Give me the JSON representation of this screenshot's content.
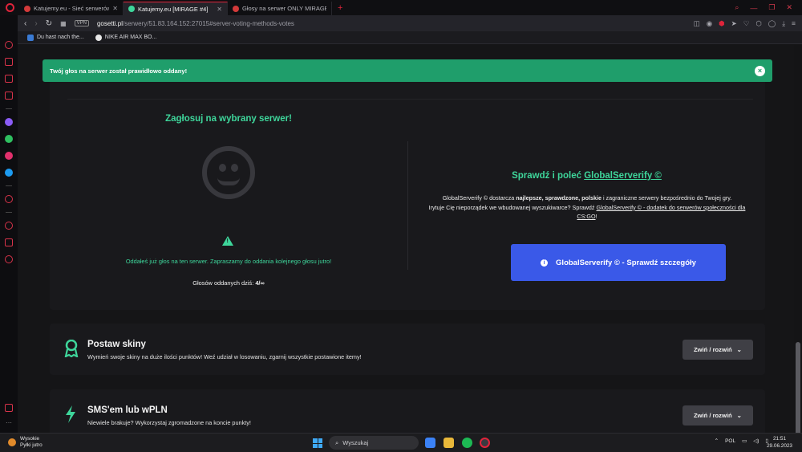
{
  "browser": {
    "tabs": [
      {
        "title": "Katujemy.eu - Sieć serwerów",
        "active": false
      },
      {
        "title": "Katujemy.eu [MIRAGE #4]",
        "active": true
      },
      {
        "title": "Głosy na serwer ONLY MIRAGE",
        "active": false
      }
    ],
    "new_tab": "+",
    "address": {
      "vpn": "VPN",
      "host": "gosetti.pl",
      "path": "/serwery/51.83.164.152:27015#server-voting-methods-votes"
    },
    "bookmarks": [
      {
        "label": "Du hast nach the..."
      },
      {
        "label": "NIKE AIR MAX BO..."
      }
    ]
  },
  "toast": {
    "message": "Twój głos na serwer został prawidłowo oddany!",
    "close": "×"
  },
  "vote": {
    "title": "Zagłosuj na wybrany serwer!",
    "already_voted": "Oddałeś już głos na ten serwer. Zapraszamy do oddania kolejnego głosu jutro!",
    "count_label": "Głosów oddanych dziś:",
    "count_value": "4/∞"
  },
  "promo": {
    "title_prefix": "Sprawdź i poleć",
    "title_link": "GlobalServerify ©",
    "desc_1": "GlobalServerify © dostarcza",
    "desc_bold": "najlepsze, sprawdzone, polskie",
    "desc_2": "i zagraniczne serwery bezpośrednio do Twojej gry.",
    "desc_3": "Irytuje Cię nieporządek we wbudowanej wyszukiwarce? Sprawdź",
    "desc_link": "GlobalServerify © - dodatek do serwerów społeczności dla CS:GO",
    "desc_end": "!",
    "button": "GlobalServerify © - Sprawdź szczegóły"
  },
  "sections": [
    {
      "title": "Postaw skiny",
      "desc": "Wymień swoje skiny na duże ilości punktów! Weź udział w losowaniu, zgarnij wszystkie postawione itemy!",
      "button": "Zwiń / rozwiń"
    },
    {
      "title": "SMS'em lub wPLN",
      "desc": "Niewiele brakuje? Wykorzystaj zgromadzone na koncie punkty!",
      "button": "Zwiń / rozwiń"
    }
  ],
  "taskbar": {
    "weather_1": "Wysokie",
    "weather_2": "Pyłki jutro",
    "search": "Wyszukaj",
    "lang": "POL",
    "time": "21:51",
    "date": "29.06.2023"
  },
  "colors": {
    "accent_green": "#3ed69b",
    "toast_green": "#1f9e6b",
    "button_blue": "#3a59e8",
    "opera_red": "#e0243b"
  }
}
